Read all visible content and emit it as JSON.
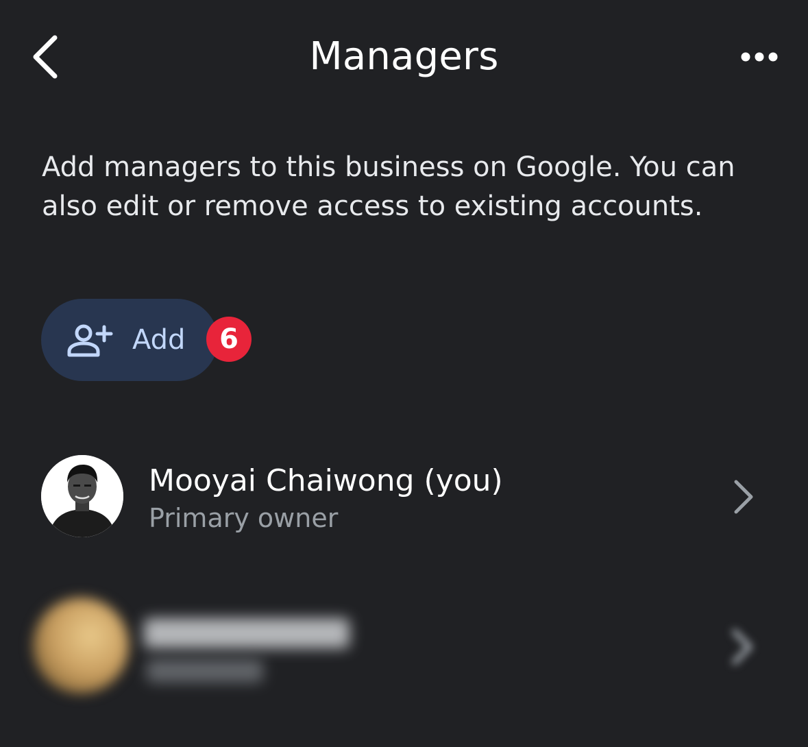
{
  "header": {
    "title": "Managers",
    "back_icon": "chevron-left-icon",
    "more_icon": "more-horizontal-icon"
  },
  "description": "Add managers to this business on Google. You can also edit or remove access to existing accounts.",
  "add_button": {
    "label": "Add",
    "icon": "person-add-icon",
    "badge": "6"
  },
  "managers": [
    {
      "name": "Mooyai Chaiwong (you)",
      "role": "Primary owner",
      "avatar": "profile-photo"
    },
    {
      "name": "",
      "role": "",
      "avatar": "blurred-profile-photo"
    }
  ],
  "colors": {
    "background": "#202124",
    "add_button_bg": "#283650",
    "add_button_text": "#c2d7fa",
    "badge": "#e8243a",
    "secondary_text": "#9aa0a6"
  }
}
